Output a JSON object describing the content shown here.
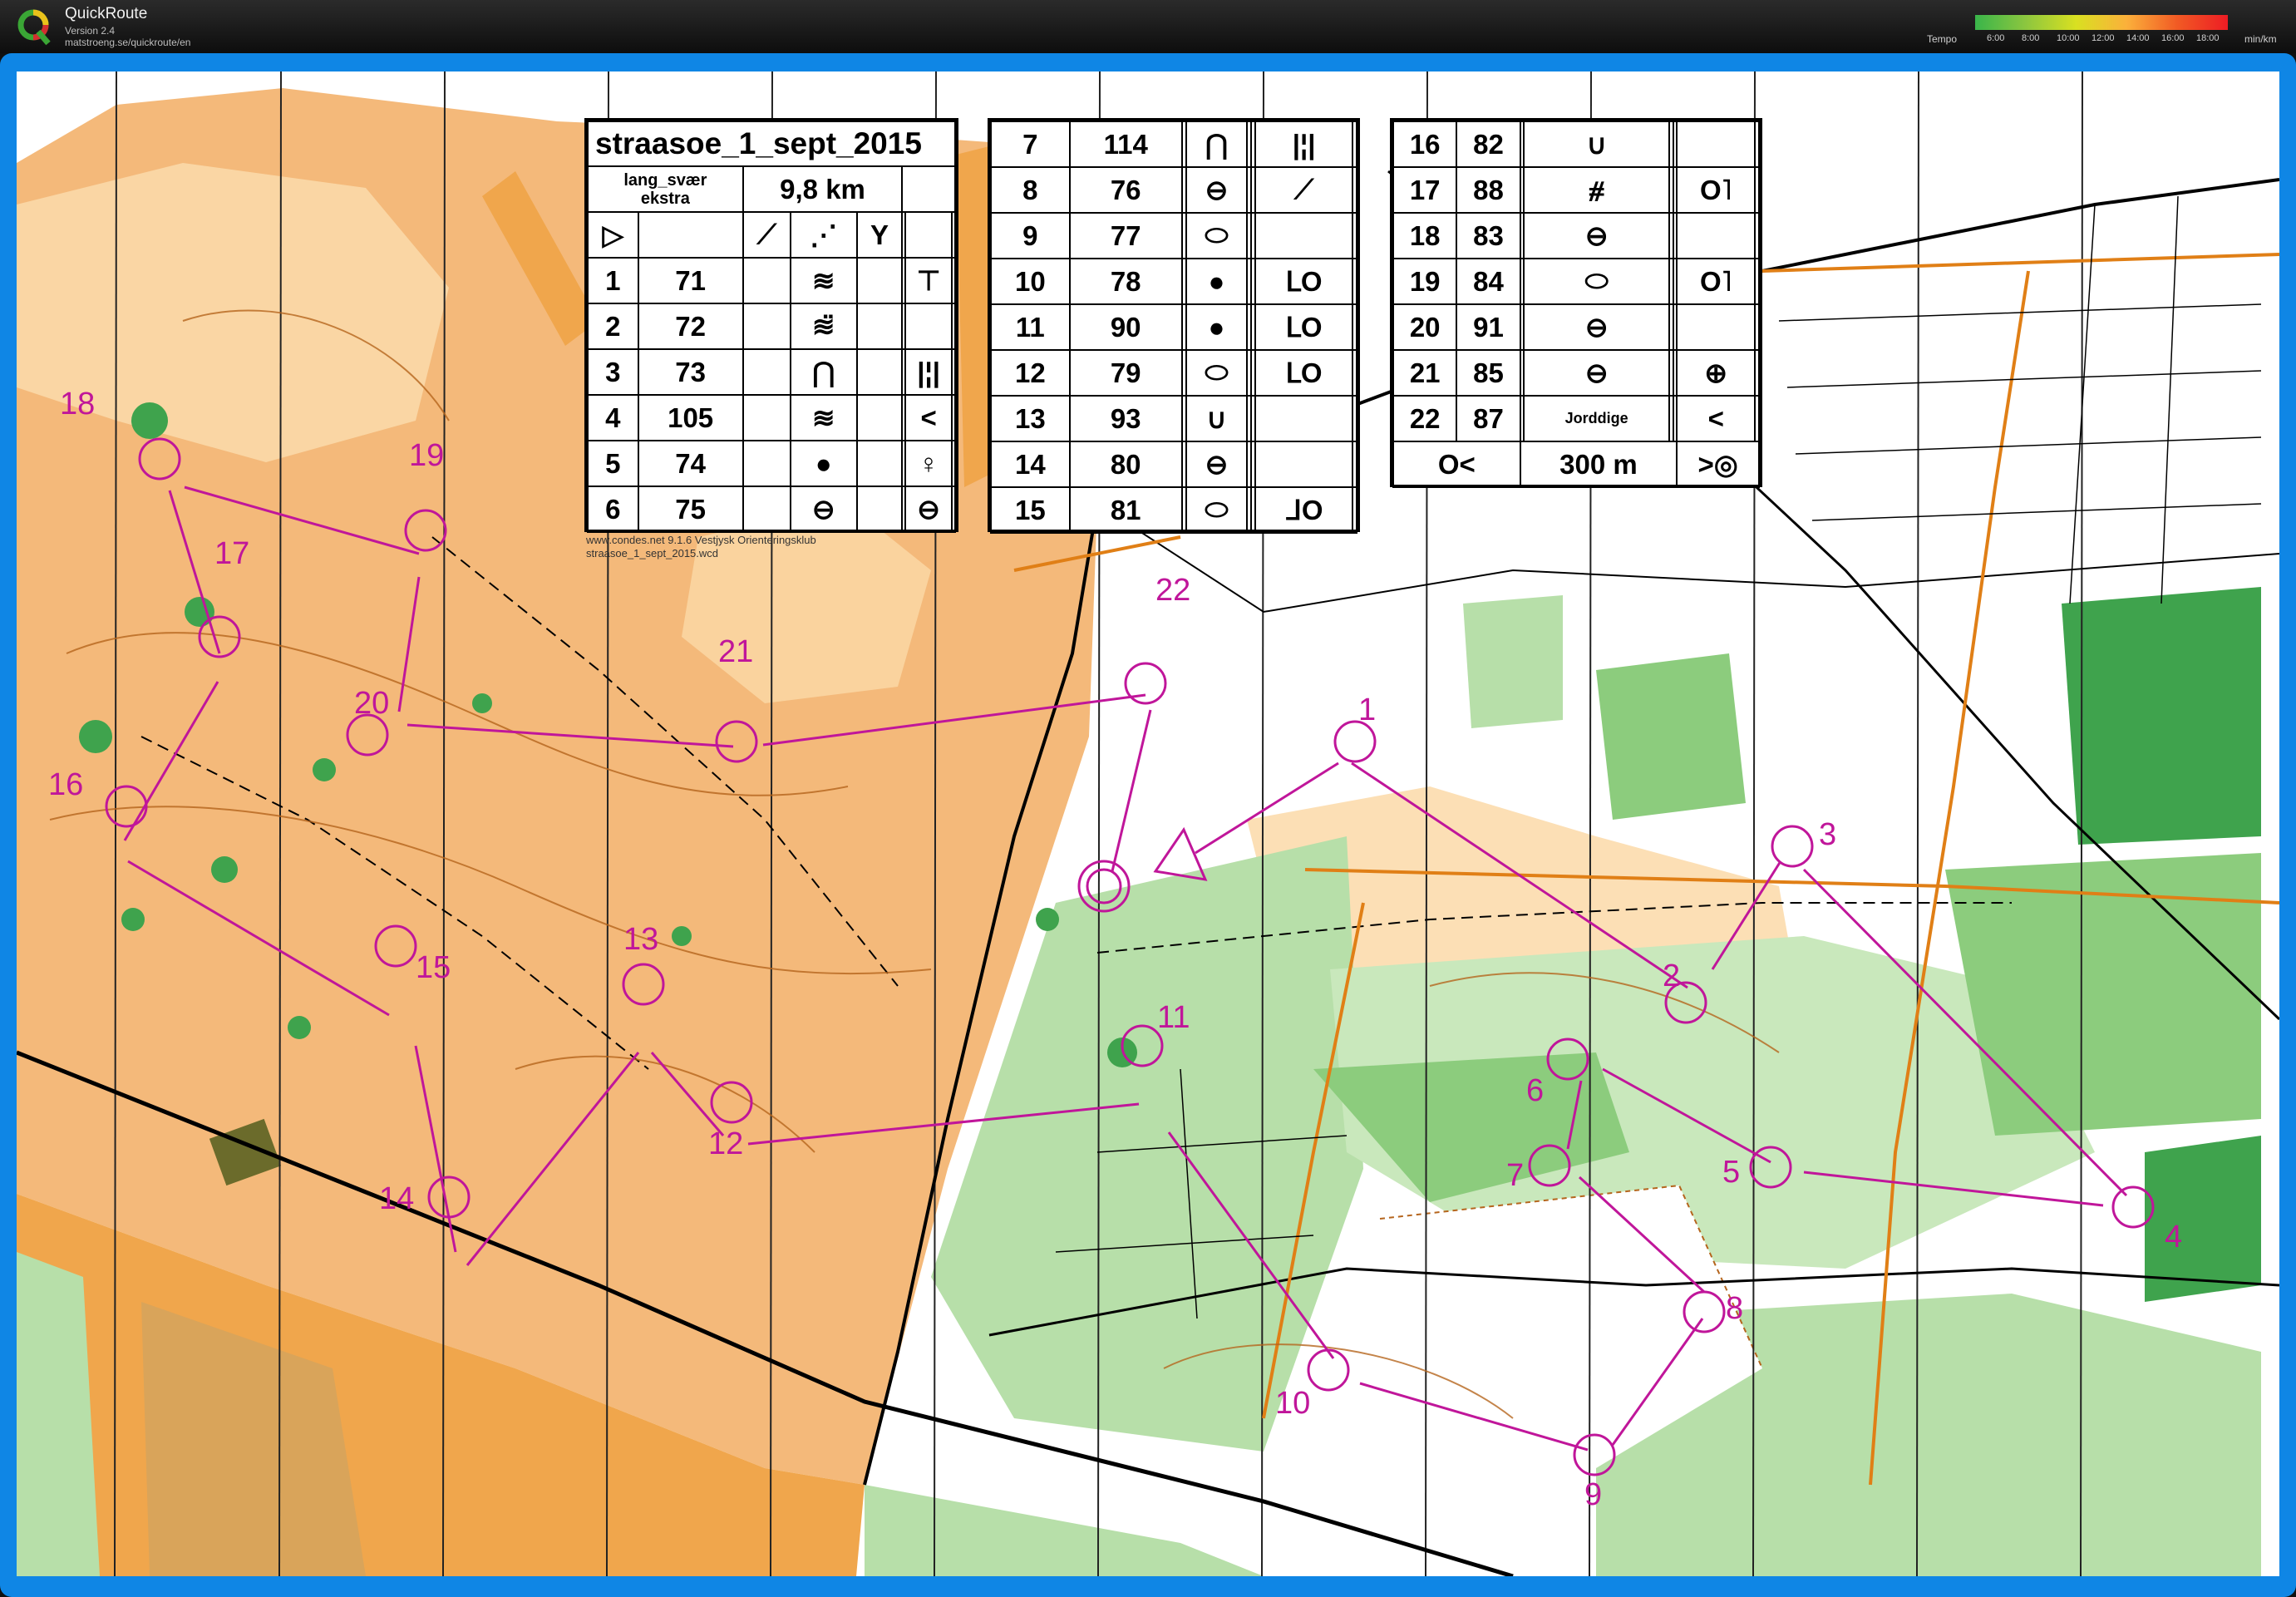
{
  "app": {
    "name": "QuickRoute",
    "version": "Version 2.4",
    "url": "matstroeng.se/quickroute/en",
    "logo_icon": "quickroute-q-logo-icon"
  },
  "tempo": {
    "label": "Tempo",
    "ticks": [
      "6:00",
      "8:00",
      "10:00",
      "12:00",
      "14:00",
      "16:00",
      "18:00"
    ],
    "unit": "min/km"
  },
  "course": {
    "title": "straasoe_1_sept_2015",
    "class_line1": "lang_svær",
    "class_line2": "ekstra",
    "length": "9,8 km",
    "finish_distance": "300 m",
    "footer_line1": "www.condes.net 9.1.6 Vestjysk Orienteringsklub",
    "footer_line2": "straasoe_1_sept_2015.wcd",
    "controls_a": [
      {
        "n": "1",
        "code": "71",
        "sym": "≋",
        "loc": "⊤"
      },
      {
        "n": "2",
        "code": "72",
        "sym": "≋̈",
        "loc": ""
      },
      {
        "n": "3",
        "code": "73",
        "sym": "⋂",
        "loc": "|¦|"
      },
      {
        "n": "4",
        "code": "105",
        "sym": "≋",
        "loc": "<"
      },
      {
        "n": "5",
        "code": "74",
        "sym": "●",
        "loc": "♀"
      },
      {
        "n": "6",
        "code": "75",
        "sym": "⊖",
        "loc": "⊖"
      }
    ],
    "controls_b": [
      {
        "n": "7",
        "code": "114",
        "sym": "⋂",
        "loc": "|¦|"
      },
      {
        "n": "8",
        "code": "76",
        "sym": "⊖",
        "loc": "⟋"
      },
      {
        "n": "9",
        "code": "77",
        "sym": "⬭",
        "loc": ""
      },
      {
        "n": "10",
        "code": "78",
        "sym": "●",
        "loc": "ᒪO"
      },
      {
        "n": "11",
        "code": "90",
        "sym": "●",
        "loc": "ᒪO"
      },
      {
        "n": "12",
        "code": "79",
        "sym": "⬭",
        "loc": "ᒪO"
      },
      {
        "n": "13",
        "code": "93",
        "sym": "∪",
        "loc": ""
      },
      {
        "n": "14",
        "code": "80",
        "sym": "⊖",
        "loc": ""
      },
      {
        "n": "15",
        "code": "81",
        "sym": "⬭",
        "loc": "ᒧO"
      }
    ],
    "controls_c": [
      {
        "n": "16",
        "code": "82",
        "sym": "∪",
        "loc": ""
      },
      {
        "n": "17",
        "code": "88",
        "sym": "⧣",
        "loc": "O˥"
      },
      {
        "n": "18",
        "code": "83",
        "sym": "⊖",
        "loc": ""
      },
      {
        "n": "19",
        "code": "84",
        "sym": "⬭",
        "loc": "O˥"
      },
      {
        "n": "20",
        "code": "91",
        "sym": "⊖",
        "loc": ""
      },
      {
        "n": "21",
        "code": "85",
        "sym": "⊖",
        "loc": "⊕"
      },
      {
        "n": "22",
        "code": "87",
        "sym": "Jorddige",
        "loc": "<"
      }
    ],
    "control_labels": [
      "1",
      "2",
      "3",
      "4",
      "5",
      "6",
      "7",
      "8",
      "9",
      "10",
      "11",
      "12",
      "13",
      "14",
      "15",
      "16",
      "17",
      "18",
      "19",
      "20",
      "21",
      "22"
    ]
  },
  "colors": {
    "course_magenta": "#c0169a",
    "open_land": "#f4b97a",
    "rough_open": "#fbd9a8",
    "forest_green": "#3fa34d",
    "light_green": "#b7dfa9",
    "contour_brown": "#b5651d",
    "frame_blue": "#0f86e5"
  }
}
